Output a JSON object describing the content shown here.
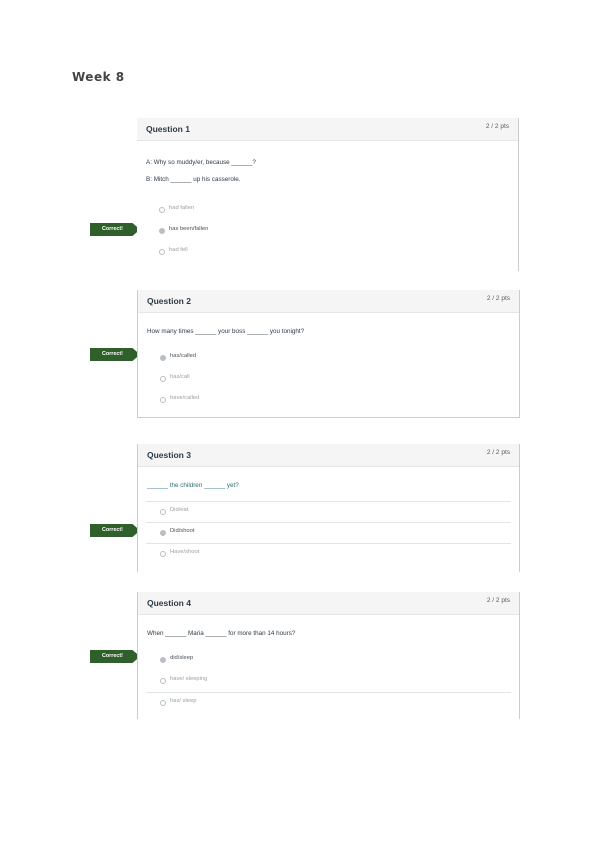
{
  "page": {
    "title": "Week 8"
  },
  "questions": [
    {
      "title": "Question 1",
      "points": "2 / 2 pts",
      "flag": "Correct!",
      "lines": [
        "A: Why so muddy/er, because ______?",
        "B: Mitch ______ up his casserole."
      ],
      "answers": [
        {
          "label": "had fallen",
          "selected": false
        },
        {
          "label": "has been/fallen",
          "selected": true
        },
        {
          "label": "had fell",
          "selected": false
        }
      ]
    },
    {
      "title": "Question 2",
      "points": "2 / 2 pts",
      "flag": "Correct!",
      "lines": [
        "How many times ______ your boss ______ you tonight?"
      ],
      "answers": [
        {
          "label": "has/called",
          "selected": true
        },
        {
          "label": "has/call",
          "selected": false
        },
        {
          "label": "have/called",
          "selected": false
        }
      ]
    },
    {
      "title": "Question 3",
      "points": "2 / 2 pts",
      "flag": "Correct!",
      "lines": [
        "______ the children ______ yet?"
      ],
      "answers": [
        {
          "label": "Did/eat",
          "selected": false
        },
        {
          "label": "Did/shoot",
          "selected": true
        },
        {
          "label": "Have/shoot",
          "selected": false
        }
      ]
    },
    {
      "title": "Question 4",
      "points": "2 / 2 pts",
      "flag": "Correct!",
      "lines": [
        "When ______ Maria ______ for more than 14 hours?"
      ],
      "answers": [
        {
          "label": "did/sleep",
          "selected": true
        },
        {
          "label": "have/ sleeping",
          "selected": false
        },
        {
          "label": "has/ sleep",
          "selected": false
        }
      ]
    }
  ]
}
